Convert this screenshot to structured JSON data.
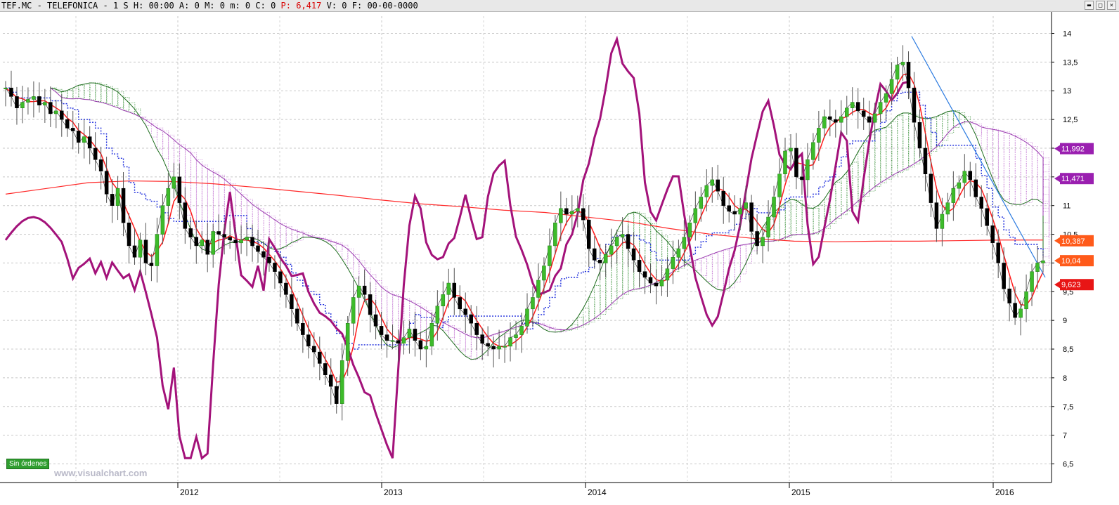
{
  "header": {
    "symbol": "TEF.MC - TELEFONICA - ",
    "timeframe": "1 S",
    "fields": [
      {
        "label": "H: ",
        "value": "00:00"
      },
      {
        "label": "A: ",
        "value": "0"
      },
      {
        "label": "M: ",
        "value": "0"
      },
      {
        "label": "m: ",
        "value": "0"
      },
      {
        "label": "C: ",
        "value": "0"
      }
    ],
    "price_label": "P: ",
    "price_value": "6,417",
    "volume_label": "V: ",
    "volume_value": "0",
    "date_label": "F: ",
    "date_value": "00-00-0000"
  },
  "window_buttons": {
    "minimize": "▬",
    "maximize": "□",
    "close": "×"
  },
  "status": {
    "orders": "Sin órdenes"
  },
  "watermark": "www.visualchart.com",
  "chart_data": {
    "type": "candlestick",
    "instrument": "TEF.MC - TELEFONICA",
    "interval": "weekly",
    "y_ticks": [
      "6,5",
      "7",
      "7,5",
      "8",
      "8,5",
      "9",
      "9,5",
      "10",
      "10,5",
      "11",
      "11,5",
      "12",
      "12,5",
      "13",
      "13,5",
      "14"
    ],
    "ylim": [
      6.2,
      14.3
    ],
    "x_ticks": [
      "2012",
      "2013",
      "2014",
      "2015",
      "2016"
    ],
    "grid": true,
    "price_flags": [
      {
        "text": "11,992",
        "value": 11.992,
        "color": "#9a1fb0"
      },
      {
        "text": "11,471",
        "value": 11.471,
        "color": "#9a1fb0"
      },
      {
        "text": "10,387",
        "value": 10.387,
        "color": "#ff5a1a"
      },
      {
        "text": "10,04",
        "value": 10.04,
        "color": "#ff5a1a"
      },
      {
        "text": "9,623",
        "value": 9.623,
        "color": "#e81515"
      }
    ],
    "series": [
      {
        "role": "price_close",
        "color": "#000000",
        "values": [
          13.05,
          12.9,
          12.7,
          12.8,
          12.85,
          12.9,
          12.75,
          12.8,
          12.6,
          12.65,
          12.5,
          12.35,
          12.3,
          12.1,
          12.2,
          12.0,
          11.8,
          11.6,
          11.2,
          11.0,
          11.3,
          10.7,
          10.3,
          10.1,
          10.4,
          10.0,
          9.95,
          10.5,
          11.0,
          11.3,
          11.5,
          11.05,
          10.6,
          10.45,
          10.3,
          10.4,
          10.15,
          10.55,
          10.5,
          10.45,
          10.4,
          10.35,
          10.4,
          10.45,
          10.3,
          10.2,
          10.1,
          10.0,
          9.85,
          9.65,
          9.45,
          9.2,
          8.95,
          8.75,
          8.55,
          8.45,
          8.25,
          8.05,
          7.85,
          7.55,
          8.3,
          8.95,
          9.4,
          9.6,
          9.45,
          9.1,
          8.9,
          8.75,
          8.65,
          8.65,
          8.6,
          8.7,
          8.85,
          8.65,
          8.5,
          8.55,
          8.95,
          9.25,
          9.45,
          9.65,
          9.4,
          9.2,
          9.1,
          8.95,
          8.75,
          8.6,
          8.55,
          8.5,
          8.55,
          8.55,
          8.7,
          8.75,
          8.9,
          9.2,
          9.4,
          9.7,
          9.95,
          10.3,
          10.7,
          10.95,
          10.85,
          10.9,
          10.95,
          10.75,
          10.25,
          10.05,
          10.0,
          10.15,
          10.3,
          10.45,
          10.5,
          10.25,
          10.05,
          9.85,
          9.75,
          9.65,
          9.6,
          9.7,
          9.9,
          10.1,
          10.25,
          10.45,
          10.7,
          10.95,
          11.15,
          11.35,
          11.45,
          11.25,
          11.0,
          10.9,
          10.85,
          10.95,
          11.05,
          10.55,
          10.3,
          10.45,
          10.8,
          11.15,
          11.55,
          11.95,
          12.0,
          11.5,
          11.45,
          11.8,
          12.1,
          12.35,
          12.55,
          12.5,
          12.45,
          12.55,
          12.7,
          12.8,
          12.65,
          12.55,
          12.45,
          12.6,
          12.8,
          12.95,
          13.2,
          13.45,
          13.5,
          13.05,
          12.45,
          12.0,
          11.55,
          11.05,
          10.6,
          10.85,
          11.05,
          11.3,
          11.4,
          11.6,
          11.45,
          11.15,
          10.95,
          10.65,
          10.35,
          10.0,
          9.55,
          9.3,
          9.05,
          9.2,
          9.5,
          9.85,
          10.0,
          10.04
        ]
      },
      {
        "role": "sma_long",
        "color": "#ff2a2a",
        "values": [
          11.2,
          11.3,
          11.4,
          11.43,
          11.42,
          11.38,
          11.32,
          11.25,
          11.18,
          11.1,
          11.03,
          10.98,
          10.92,
          10.88,
          10.8,
          10.72,
          10.6,
          10.5,
          10.43,
          10.38,
          10.37,
          10.38,
          10.38,
          10.39,
          10.4,
          10.4
        ]
      }
    ],
    "x_date_range": [
      "2011-05",
      "2016-04"
    ]
  }
}
